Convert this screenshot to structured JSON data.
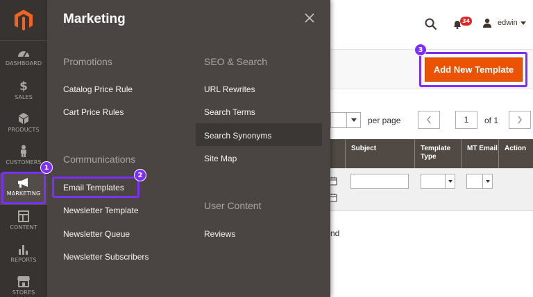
{
  "sidebar": {
    "items": [
      {
        "label": "DASHBOARD",
        "icon": "dashboard-icon"
      },
      {
        "label": "SALES",
        "icon": "dollar-icon"
      },
      {
        "label": "PRODUCTS",
        "icon": "cube-icon"
      },
      {
        "label": "CUSTOMERS",
        "icon": "person-icon"
      },
      {
        "label": "MARKETING",
        "icon": "megaphone-icon"
      },
      {
        "label": "CONTENT",
        "icon": "layout-icon"
      },
      {
        "label": "REPORTS",
        "icon": "bar-chart-icon"
      },
      {
        "label": "STORES",
        "icon": "store-icon"
      }
    ]
  },
  "flyout": {
    "title": "Marketing",
    "sections": {
      "promotions": {
        "title": "Promotions",
        "links": [
          "Catalog Price Rule",
          "Cart Price Rules"
        ]
      },
      "communications": {
        "title": "Communications",
        "links": [
          "Email Templates",
          "Newsletter Template",
          "Newsletter Queue",
          "Newsletter Subscribers"
        ]
      },
      "seo": {
        "title": "SEO & Search",
        "links": [
          "URL Rewrites",
          "Search Terms",
          "Search Synonyms",
          "Site Map"
        ]
      },
      "user_content": {
        "title": "User Content",
        "links": [
          "Reviews"
        ]
      }
    }
  },
  "header": {
    "notification_count": "34",
    "username": "edwin"
  },
  "actions": {
    "add_new_template": "Add New Template"
  },
  "pager": {
    "per_page_label": "per page",
    "current_page": "1",
    "of_label": "of 1"
  },
  "grid": {
    "columns": [
      "Subject",
      "Template Type",
      "MT Email",
      "Action"
    ],
    "no_records_fragment": "nd"
  },
  "callouts": [
    "1",
    "2",
    "3"
  ],
  "colors": {
    "sidebar_bg": "#373330",
    "flyout_bg": "#4a4542",
    "accent_orange": "#eb5202",
    "logo_orange": "#f26322",
    "callout_purple": "#7b2ff7",
    "badge_red": "#e22626"
  }
}
